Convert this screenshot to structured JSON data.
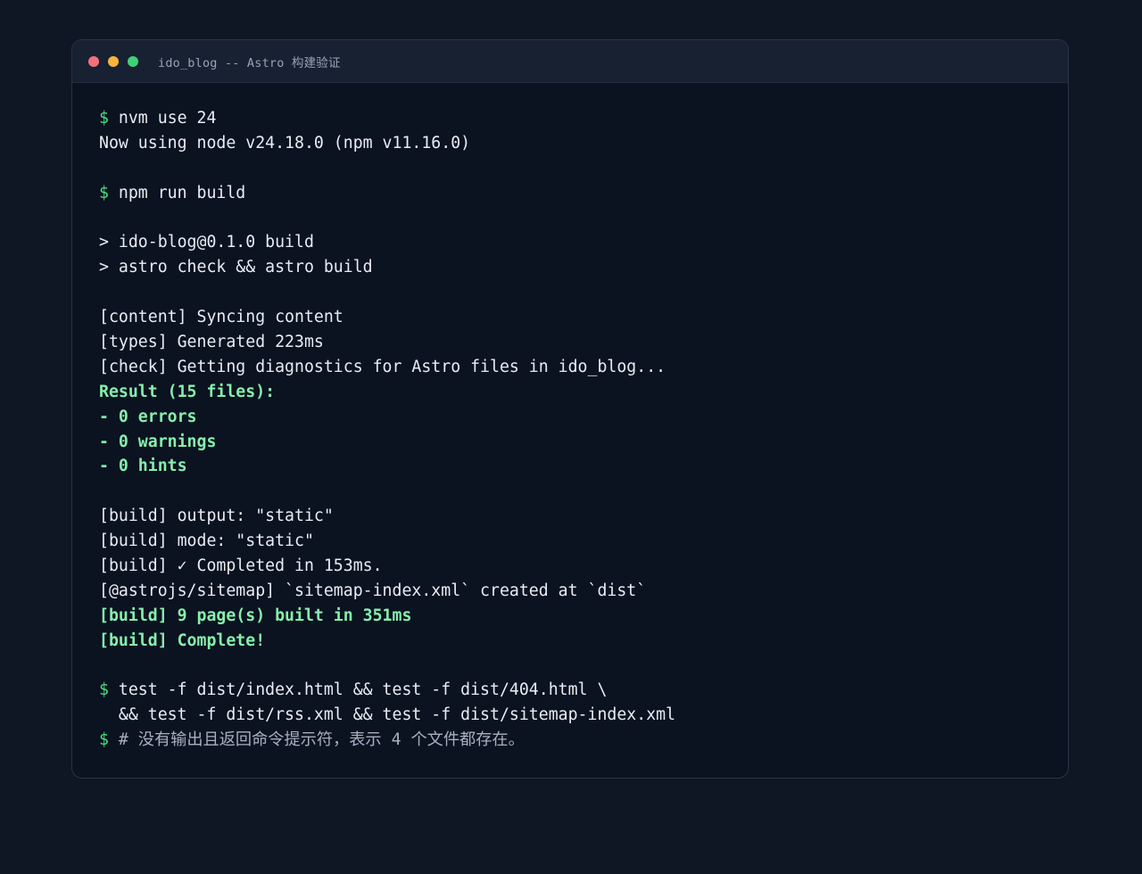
{
  "window": {
    "title": "ido_blog -- Astro 构建验证",
    "traffic_light_colors": [
      "#f3707a",
      "#f5b53a",
      "#3fd07a"
    ]
  },
  "terminal": {
    "prompt_symbol": "$",
    "lines": [
      {
        "kind": "command",
        "text": "nvm use 24"
      },
      {
        "kind": "output",
        "text": "Now using node v24.18.0 (npm v11.16.0)"
      },
      {
        "kind": "blank",
        "text": ""
      },
      {
        "kind": "command",
        "text": "npm run build"
      },
      {
        "kind": "blank",
        "text": ""
      },
      {
        "kind": "output",
        "text": "> ido-blog@0.1.0 build"
      },
      {
        "kind": "output",
        "text": "> astro check && astro build"
      },
      {
        "kind": "blank",
        "text": ""
      },
      {
        "kind": "output",
        "text": "[content] Syncing content"
      },
      {
        "kind": "output",
        "text": "[types] Generated 223ms"
      },
      {
        "kind": "output",
        "text": "[check] Getting diagnostics for Astro files in ido_blog..."
      },
      {
        "kind": "success",
        "text": "Result (15 files):"
      },
      {
        "kind": "success",
        "text": "- 0 errors"
      },
      {
        "kind": "success",
        "text": "- 0 warnings"
      },
      {
        "kind": "success",
        "text": "- 0 hints"
      },
      {
        "kind": "blank",
        "text": ""
      },
      {
        "kind": "output",
        "text": "[build] output: \"static\""
      },
      {
        "kind": "output",
        "text": "[build] mode: \"static\""
      },
      {
        "kind": "output",
        "text": "[build] ✓ Completed in 153ms."
      },
      {
        "kind": "output",
        "text": "[@astrojs/sitemap] `sitemap-index.xml` created at `dist`"
      },
      {
        "kind": "success",
        "text": "[build] 9 page(s) built in 351ms"
      },
      {
        "kind": "success",
        "text": "[build] Complete!"
      },
      {
        "kind": "blank",
        "text": ""
      },
      {
        "kind": "command",
        "text": "test -f dist/index.html && test -f dist/404.html \\"
      },
      {
        "kind": "output",
        "text": "  && test -f dist/rss.xml && test -f dist/sitemap-index.xml"
      },
      {
        "kind": "comment",
        "text": "# 没有输出且返回命令提示符，表示 4 个文件都存在。"
      }
    ]
  },
  "colors": {
    "background": "#0f1624",
    "terminal_bg": "#0b1220",
    "titlebar_bg": "#172131",
    "prompt": "#4ade80",
    "success": "#86efac",
    "text": "#e8edf4",
    "comment": "#a6b0c0"
  }
}
